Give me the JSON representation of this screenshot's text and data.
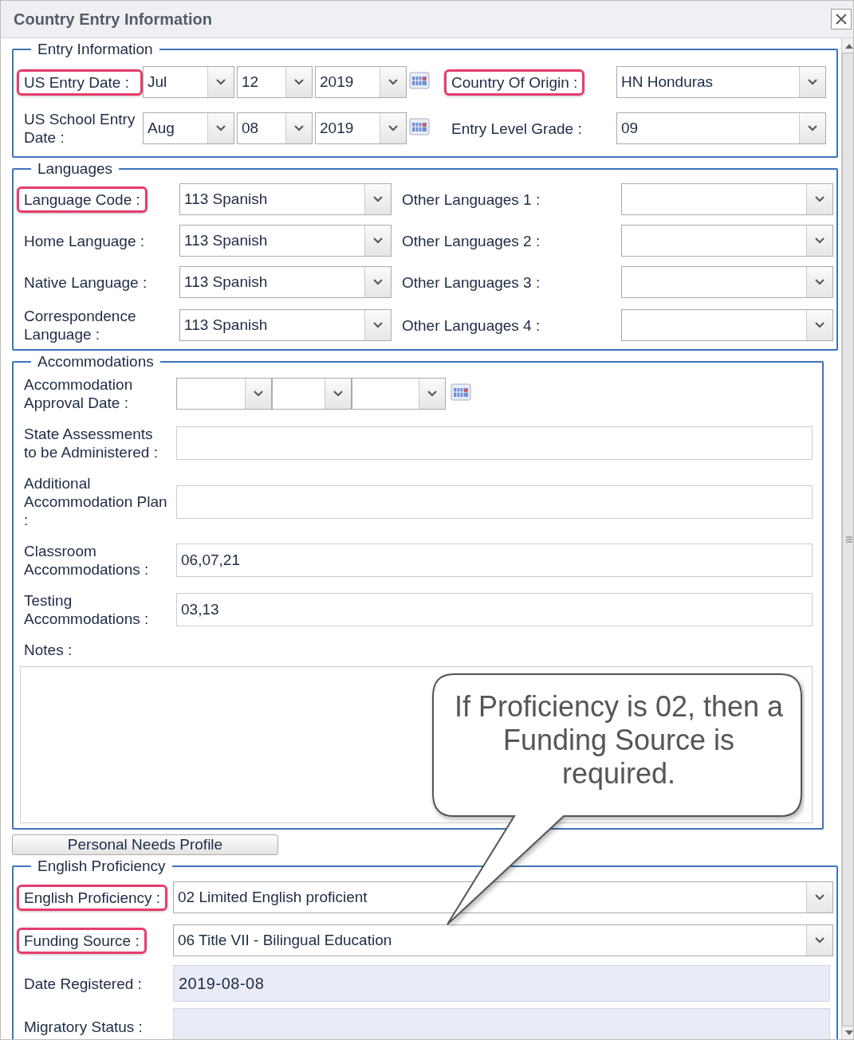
{
  "window": {
    "title": "Country Entry Information"
  },
  "entry_information": {
    "legend": "Entry Information",
    "rows": [
      {
        "label": "US Entry Date :",
        "highlighted": true,
        "month": "Jul",
        "day": "12",
        "year": "2019",
        "side_label": "Country Of Origin :",
        "side_highlighted": true,
        "side_value": "HN Honduras"
      },
      {
        "label": "US School Entry Date :",
        "highlighted": false,
        "month": "Aug",
        "day": "08",
        "year": "2019",
        "side_label": "Entry Level Grade :",
        "side_highlighted": false,
        "side_value": "09"
      }
    ]
  },
  "languages": {
    "legend": "Languages",
    "rows": [
      {
        "label": "Language Code :",
        "highlighted": true,
        "value": "113 Spanish",
        "other_label": "Other Languages 1 :"
      },
      {
        "label": "Home Language :",
        "highlighted": false,
        "value": "113 Spanish",
        "other_label": "Other Languages 2 :"
      },
      {
        "label": "Native Language :",
        "highlighted": false,
        "value": "113 Spanish",
        "other_label": "Other Languages 3 :"
      },
      {
        "label": "Correspondence Language :",
        "highlighted": false,
        "value": "113 Spanish",
        "other_label": "Other Languages 4 :"
      }
    ]
  },
  "accommodations": {
    "legend": "Accommodations",
    "approval_date_label": "Accommodation Approval Date :",
    "fields": [
      {
        "label": "State Assessments to be Administered :"
      },
      {
        "label": "Additional Accommodation Plan :"
      },
      {
        "label": "Classroom Accommodations :",
        "value": "06,07,21"
      },
      {
        "label": "Testing Accommodations :",
        "value": "03,13"
      }
    ],
    "notes_label": "Notes :"
  },
  "personal_needs_button": "Personal Needs Profile",
  "english_proficiency": {
    "legend": "English Proficiency",
    "rows": [
      {
        "kind": "select",
        "label": "English Proficiency :",
        "highlighted": true,
        "value": "02 Limited English proficient"
      },
      {
        "kind": "select",
        "label": "Funding Source :",
        "highlighted": true,
        "value": "06 Title VII - Bilingual Education"
      },
      {
        "kind": "readonly",
        "label": "Date Registered :",
        "highlighted": false,
        "value": "2019-08-08"
      },
      {
        "kind": "readonly",
        "label": "Migratory Status :",
        "highlighted": false
      }
    ]
  },
  "callout": {
    "text": "If Proficiency is 02, then a Funding Source is required."
  }
}
